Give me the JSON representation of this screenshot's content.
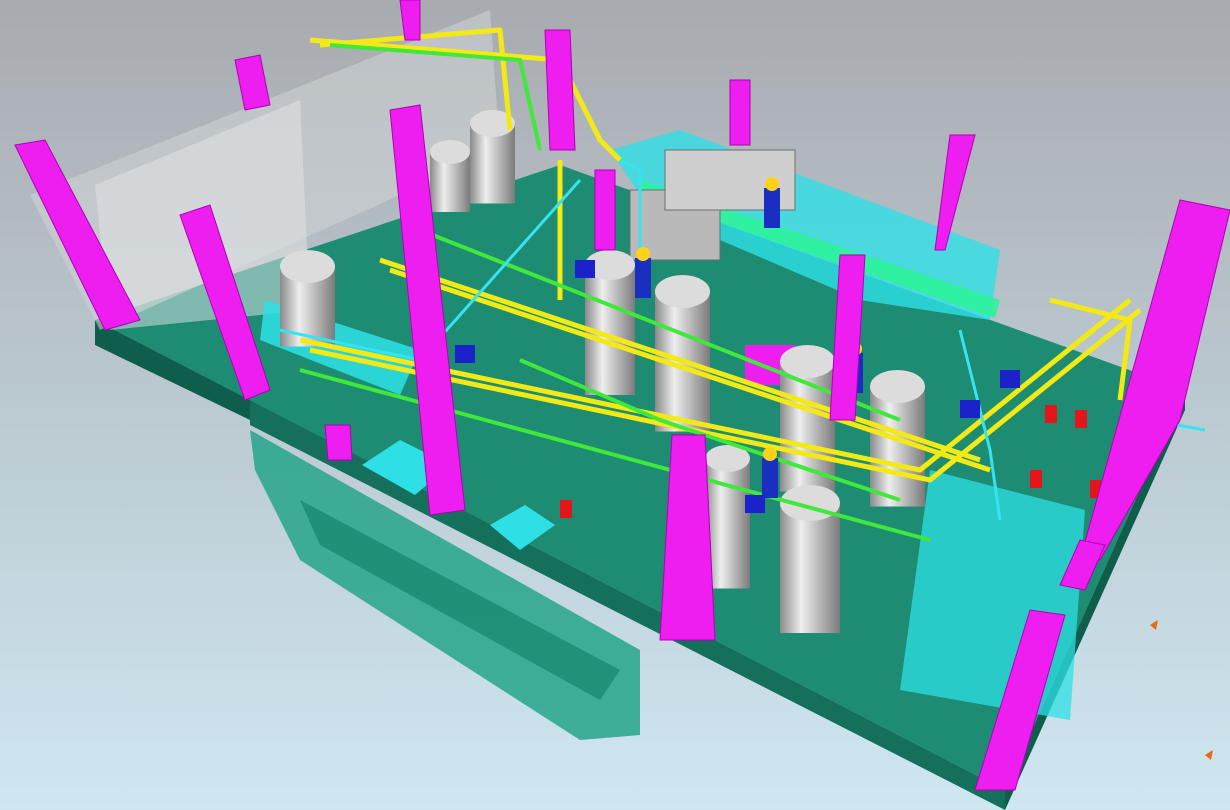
{
  "scene": {
    "kind": "3d-cad-plant-model",
    "palette": {
      "background_top": "#a8abb0",
      "background_bottom": "#cfe7f1",
      "floor": "#1d8c72",
      "floor_dark": "#14705b",
      "floor_edge": "#0f5e4c",
      "pit": "#26a58a",
      "column": "#ee1df0",
      "column_shade": "#b000b4",
      "pipe_yellow": "#f3ea15",
      "pipe_green": "#3fe83b",
      "pipe_cyan": "#36e3f0",
      "tank": "#c9c9c9",
      "tank_shade": "#8a8a8a",
      "panel_cyan": "#2ee0e6",
      "panel_glass": "#cfd3d6",
      "worker_body": "#1a2fc2",
      "worker_helmet": "#ffd21a",
      "valve_red": "#e3161b",
      "pump_blue": "#1b22c9"
    },
    "counts": {
      "columns": 15,
      "workers": 4,
      "tall_vessels": 5
    }
  }
}
